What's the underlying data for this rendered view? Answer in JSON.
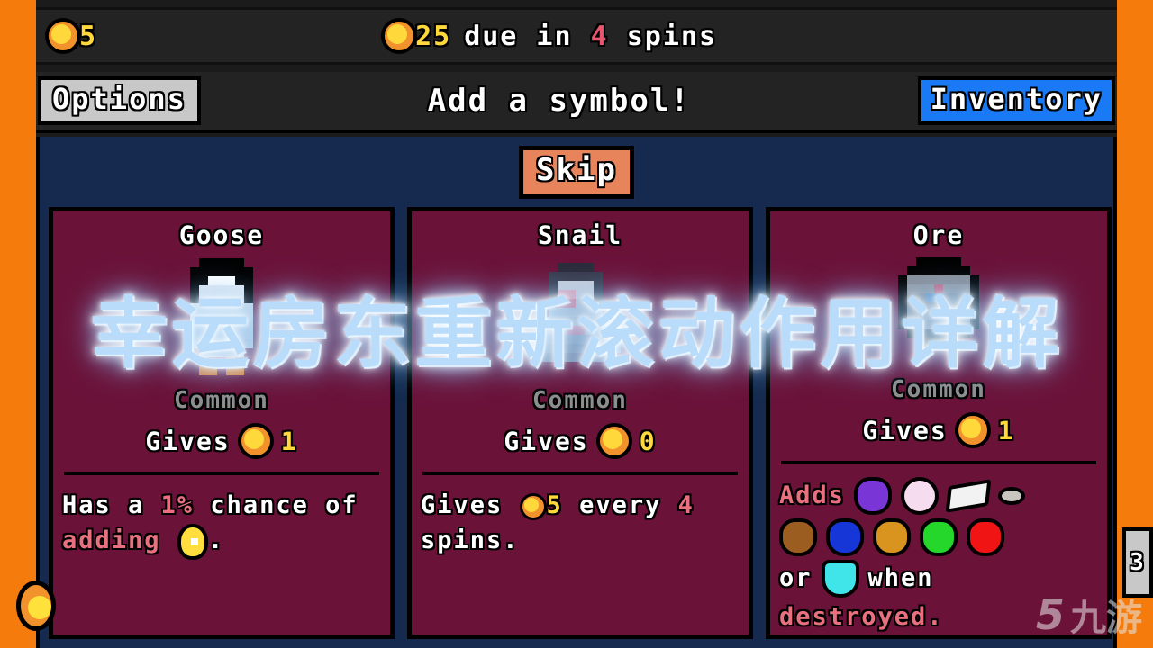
{
  "colors": {
    "frame_orange": "#F57C0C",
    "panel_navy": "#152A4E",
    "card_maroon": "#6B1239",
    "bar_dark": "#232323",
    "coin_yellow": "#FFD93B",
    "coin_rim": "#F2922C",
    "accent_red": "#E8556E",
    "inventory_blue": "#1A7AF5",
    "options_gray": "#C8C8C8",
    "skip_salmon": "#E8845C",
    "rarity_gray": "#8E8E8E"
  },
  "topbar": {
    "coin_icon": "coin-icon",
    "coins": "5",
    "rent_coin_icon": "coin-icon",
    "rent_amount": "25",
    "due_prefix": "due in",
    "due_spins": "4",
    "due_suffix": "spins"
  },
  "navbar": {
    "options_label": "Options",
    "title": "Add a symbol!",
    "inventory_label": "Inventory"
  },
  "panel": {
    "skip_label": "Skip"
  },
  "cards": [
    {
      "name": "Goose",
      "sprite": "goose-sprite",
      "rarity": "Common",
      "gives_label": "Gives",
      "gives_coin_icon": "coin-icon",
      "gives_value": "1",
      "desc_parts": [
        {
          "text": "Has a ",
          "style": "normal"
        },
        {
          "text": "1%",
          "style": "highlight"
        },
        {
          "text": " chance of ",
          "style": "normal"
        },
        {
          "text": "adding",
          "style": "highlight"
        },
        {
          "text": " ",
          "style": "normal"
        },
        {
          "text": "golden-egg-icon",
          "style": "icon-egg"
        },
        {
          "text": ".",
          "style": "normal"
        }
      ]
    },
    {
      "name": "Snail",
      "sprite": "snail-sprite",
      "rarity": "Common",
      "gives_label": "Gives",
      "gives_coin_icon": "coin-icon",
      "gives_value": "0",
      "desc_parts": [
        {
          "text": "Gives ",
          "style": "normal"
        },
        {
          "text": "coin-icon",
          "style": "icon-coin"
        },
        {
          "text": "5",
          "style": "yellow"
        },
        {
          "text": " every ",
          "style": "normal"
        },
        {
          "text": "4",
          "style": "highlight"
        },
        {
          "text": " spins.",
          "style": "normal"
        }
      ]
    },
    {
      "name": "Ore",
      "sprite": "ore-sprite",
      "rarity": "Common",
      "gives_label": "Gives",
      "gives_coin_icon": "coin-icon",
      "gives_value": "1",
      "desc_parts": [
        {
          "text": "Adds",
          "style": "highlight"
        },
        {
          "text": "gems-row",
          "style": "icon-gems"
        },
        {
          "text": "or",
          "style": "normal"
        },
        {
          "text": "diamond-icon",
          "style": "icon-diamond"
        },
        {
          "text": "when",
          "style": "normal"
        },
        {
          "text": "destroyed.",
          "style": "highlight"
        }
      ],
      "gems": [
        {
          "name": "amethyst-gem-icon",
          "color": "#7A35D6",
          "shape": "gem"
        },
        {
          "name": "pearl-gem-icon",
          "color": "#F6DCEF",
          "shape": "round"
        },
        {
          "name": "shard-gem-icon",
          "color": "#F2F2F2",
          "shape": "shard"
        },
        {
          "name": "pebble-gem-icon",
          "color": "#C9C6C0",
          "shape": "pebble"
        },
        {
          "name": "brown-gem-icon",
          "color": "#9C5E20",
          "shape": "gem"
        },
        {
          "name": "sapphire-gem-icon",
          "color": "#1736D8",
          "shape": "gem"
        },
        {
          "name": "gold-gem-icon",
          "color": "#D8941E",
          "shape": "gem"
        },
        {
          "name": "emerald-gem-icon",
          "color": "#25D62B",
          "shape": "gem"
        },
        {
          "name": "ruby-gem-icon",
          "color": "#F01414",
          "shape": "gem"
        }
      ],
      "diamond": {
        "name": "diamond-icon",
        "color": "#3FE5E8",
        "shape": "diamond"
      }
    }
  ],
  "edges": {
    "right_tab_label": "3"
  },
  "watermarks": {
    "overlay_text": "幸运房东重新滚动作用详解",
    "brand_mark": "5",
    "brand_cn": "九游"
  }
}
